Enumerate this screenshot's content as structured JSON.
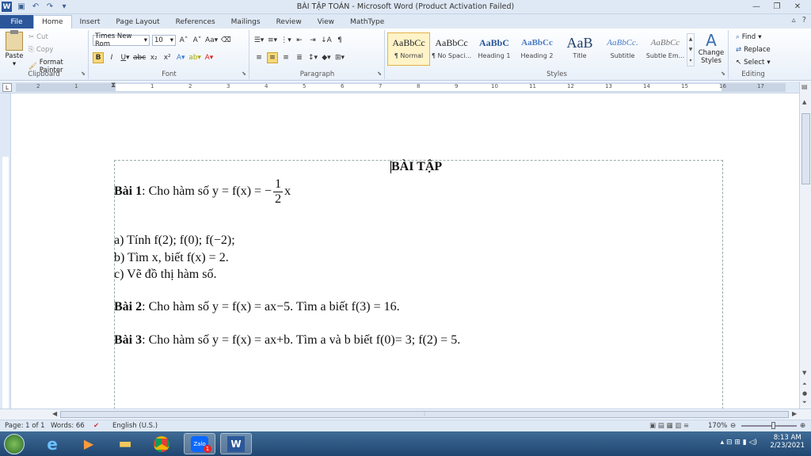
{
  "window": {
    "title": "BÀI TẬP TOÁN - Microsoft Word (Product Activation Failed)"
  },
  "tabs": [
    {
      "label": "File"
    },
    {
      "label": "Home"
    },
    {
      "label": "Insert"
    },
    {
      "label": "Page Layout"
    },
    {
      "label": "References"
    },
    {
      "label": "Mailings"
    },
    {
      "label": "Review"
    },
    {
      "label": "View"
    },
    {
      "label": "MathType"
    }
  ],
  "ribbon": {
    "clipboard": {
      "label": "Clipboard",
      "paste": "Paste",
      "cut": "Cut",
      "copy": "Copy",
      "format_painter": "Format Painter"
    },
    "font": {
      "label": "Font",
      "name": "Times New Rom",
      "size": "10"
    },
    "paragraph": {
      "label": "Paragraph"
    },
    "styles": {
      "label": "Styles",
      "items": [
        {
          "preview": "AaBbCc",
          "name": "¶ Normal"
        },
        {
          "preview": "AaBbCc",
          "name": "¶ No Spaci..."
        },
        {
          "preview": "AaBbC",
          "name": "Heading 1"
        },
        {
          "preview": "AaBbCc",
          "name": "Heading 2"
        },
        {
          "preview": "AaB",
          "name": "Title"
        },
        {
          "preview": "AaBbCc.",
          "name": "Subtitle"
        },
        {
          "preview": "AaBbCc",
          "name": "Subtle Em..."
        }
      ],
      "change": "Change Styles"
    },
    "editing": {
      "label": "Editing",
      "find": "Find",
      "replace": "Replace",
      "select": "Select"
    }
  },
  "ruler": {
    "numbers": [
      "2",
      "1",
      "1",
      "2",
      "3",
      "4",
      "5",
      "6",
      "7",
      "8",
      "9",
      "10",
      "11",
      "12",
      "13",
      "14",
      "15",
      "16",
      "17"
    ]
  },
  "document": {
    "heading": "BÀI TẬP",
    "bai1": {
      "label": "Bài 1",
      "text": ": Cho hàm số y = f(x) = ",
      "sign": "−",
      "num": "1",
      "den": "2",
      "tail": "x"
    },
    "a": "a) Tính f(2);  f(0);  f(−2);",
    "b": "b) Tìm x, biết f(x) = 2.",
    "c": "c) Vẽ đồ thị hàm số.",
    "bai2": {
      "label": "Bài 2",
      "text": ": Cho hàm số y = f(x) = ax−5. Tìm a biết  f(3) = 16."
    },
    "bai3": {
      "label": "Bài 3",
      "text": ": Cho hàm số y = f(x) = ax+b. Tìm a và b biết  f(0)= 3;  f(2) = 5."
    }
  },
  "status": {
    "page": "Page: 1 of 1",
    "words": "Words: 66",
    "language": "English (U.S.)",
    "zoom": "170%"
  },
  "taskbar": {
    "time": "8:13 AM",
    "date": "2/23/2021",
    "zalo_badge": "1"
  }
}
